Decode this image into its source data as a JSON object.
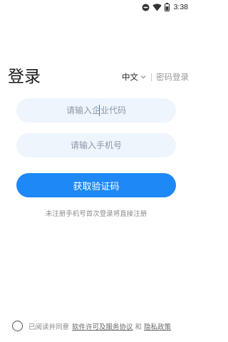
{
  "status_bar": {
    "time": "3:38",
    "icons": [
      "do-not-disturb-icon",
      "wifi-icon",
      "battery-icon"
    ]
  },
  "header": {
    "title": "登录",
    "language": "中文",
    "password_login": "密码登录"
  },
  "form": {
    "company_code_placeholder": "请输入企业代码",
    "phone_placeholder": "请输入手机号",
    "submit_label": "获取验证码",
    "hint": "未注册手机号首次登录将直接注册"
  },
  "agreement": {
    "checked": false,
    "prefix": "已阅读并同意",
    "license_link": "软件许可及服务协议",
    "conjunction": "和",
    "privacy_link": "隐私政策"
  },
  "colors": {
    "accent": "#1e88f7",
    "input_bg": "#eef5fd",
    "caret": "#1e90ff"
  }
}
